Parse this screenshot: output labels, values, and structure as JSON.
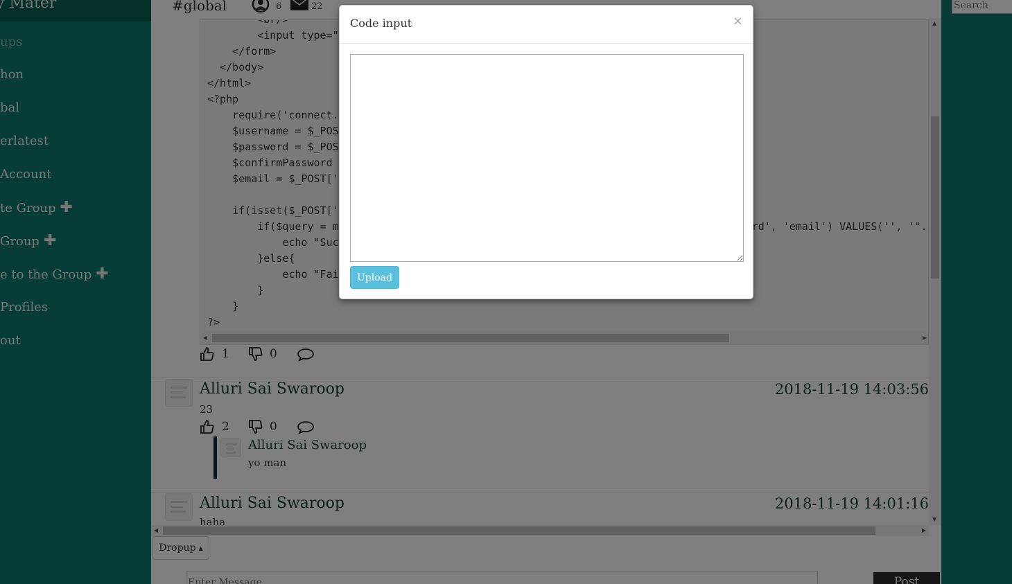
{
  "sidebar": {
    "brand": "y Mater",
    "items": [
      {
        "label": "ups",
        "dim": true
      },
      {
        "label": "hon"
      },
      {
        "label": "bal"
      },
      {
        "label": "erlatest"
      },
      {
        "label": "Account"
      },
      {
        "label": "te Group",
        "plus": true
      },
      {
        "label": "Group",
        "plus": true
      },
      {
        "label": "e to the Group",
        "plus": true
      },
      {
        "label": " Profiles"
      },
      {
        "label": "out"
      }
    ]
  },
  "header": {
    "channel": "#global",
    "online_count": "6",
    "mail_count": "22"
  },
  "code_post": {
    "code": "        <br/>\n        <input type=\"submit\" value=\"Register\"/><br/><br/><a href=\"login.php\">Log in</a>\n    </form>\n  </body>\n</html>\n<?php\n    require('connect.php');\n    $username = $_POST['username'];\n    $password = $_POST['password'];\n    $confirmPassword = $_POST['confirmPassword'];\n    $email = $_POST['email'];\n\n    if(isset($_POST['submit'])){\n        if($query = mysqli_query($conn, \"INSERT INTO `users` ('id', 'username', 'password', 'email') VALUES('', '\".$username.\"', '\".$password.\"', '\".$email.\"')\")){\n            echo \"Success\";\n        }else{\n            echo \"Failure\";\n        }\n    }\n?>",
    "likes": "1",
    "dislikes": "0"
  },
  "messages": [
    {
      "author": "Alluri Sai Swaroop",
      "time": "2018-11-19 14:03:56",
      "text": "23",
      "likes": "2",
      "dislikes": "0",
      "reply": {
        "author": "Alluri Sai Swaroop",
        "text": "yo man"
      }
    },
    {
      "author": "Alluri Sai Swaroop",
      "time": "2018-11-19 14:01:16",
      "text": "haha"
    }
  ],
  "composer": {
    "dropup_label": "Dropup",
    "input_placeholder": "Enter Message",
    "post_label": "Post"
  },
  "search": {
    "placeholder": "Search"
  },
  "modal": {
    "title": "Code input",
    "close": "×",
    "textarea_value": "",
    "upload_label": "Upload"
  },
  "colors": {
    "sidebar": "#0f7b6c",
    "brand_bar": "#0b5e52",
    "accent_text": "#17403a",
    "upload": "#5bc0de",
    "reply_bar": "#0e2f44"
  },
  "icons": [
    "user-icon",
    "mail-icon",
    "thumbs-up-icon",
    "thumbs-down-icon",
    "comment-icon",
    "plus-icon",
    "close-icon",
    "caret-up-icon"
  ]
}
